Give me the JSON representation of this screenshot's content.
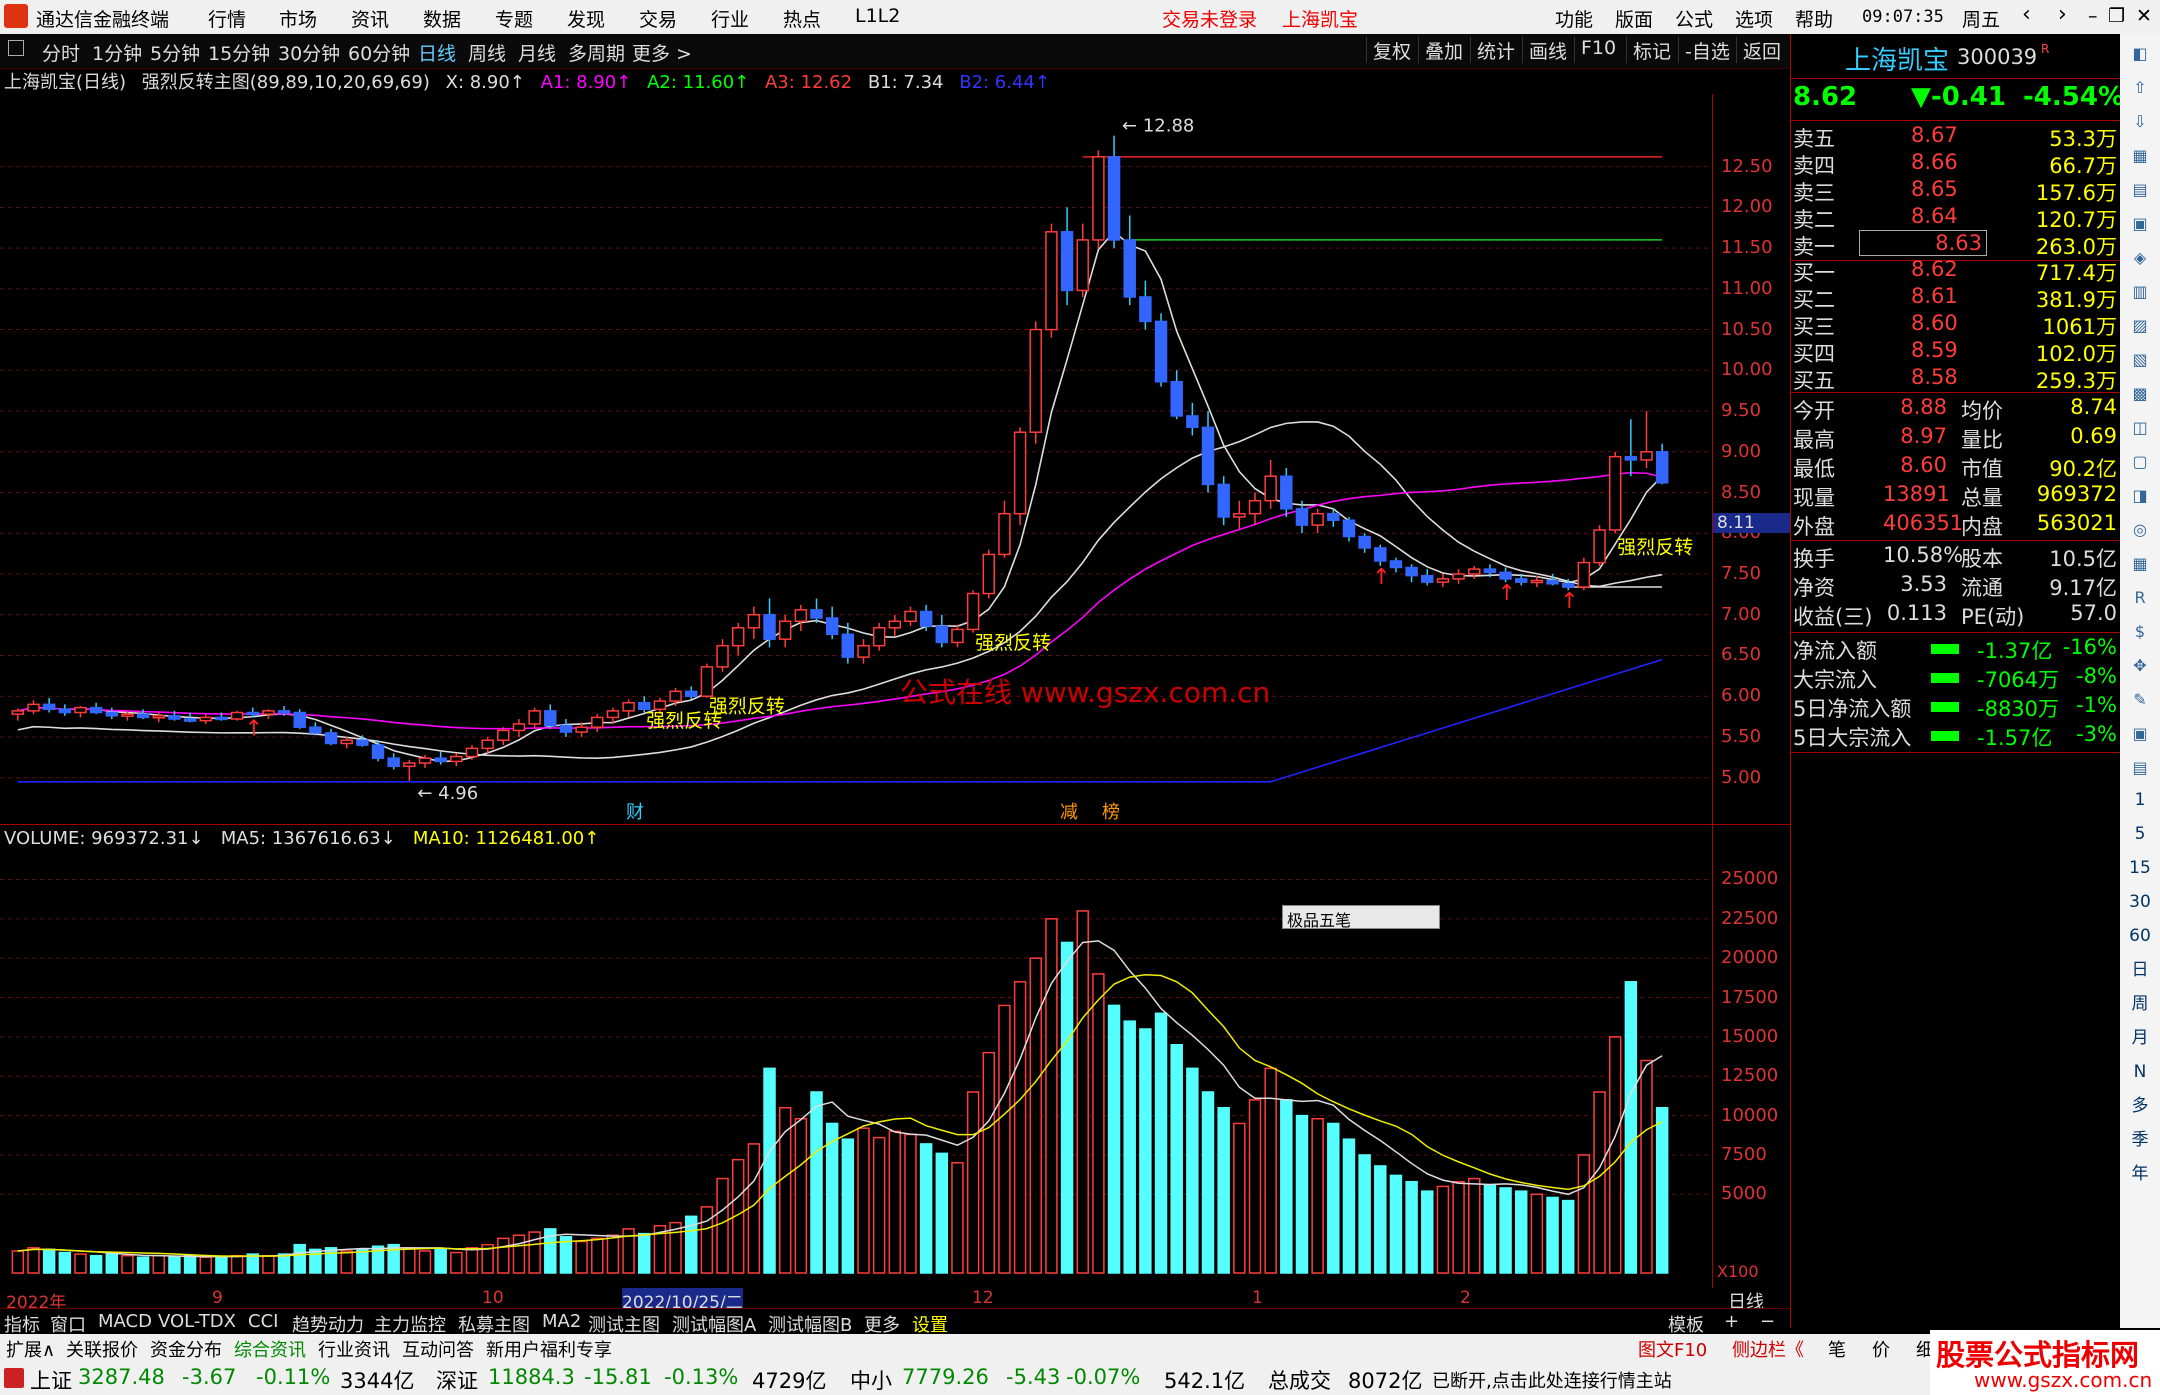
{
  "menubar": {
    "app_title": "通达信金融终端",
    "items": [
      "行情",
      "市场",
      "资讯",
      "数据",
      "专题",
      "发现",
      "交易",
      "行业",
      "热点",
      "L1L2"
    ],
    "status": "交易未登录",
    "stock": "上海凯宝",
    "right_items": [
      "功能",
      "版面",
      "公式",
      "选项",
      "帮助"
    ],
    "time": "09:07:35",
    "weekday": "周五"
  },
  "toolbar": {
    "periods": [
      "分时",
      "1分钟",
      "5分钟",
      "15分钟",
      "30分钟",
      "60分钟",
      "日线",
      "周线",
      "月线",
      "多周期",
      "更多 >"
    ],
    "selected": "日线",
    "right_buttons": [
      "复权",
      "叠加",
      "统计",
      "画线",
      "F10",
      "标记",
      "-自选",
      "返回"
    ]
  },
  "infoline": {
    "title": "上海凯宝(日线)",
    "formula": "强烈反转主图(89,89,10,20,69,69)",
    "x": "X: 8.90↑",
    "a1": "A1: 8.90↑",
    "a2": "A2: 11.60↑",
    "a3": "A3: 12.62",
    "b1": "B1: 7.34",
    "b2": "B2: 6.44↑"
  },
  "main_axis": [
    "12.50",
    "12.00",
    "11.50",
    "11.00",
    "10.50",
    "10.00",
    "9.50",
    "9.00",
    "8.50",
    "8.00",
    "7.50",
    "7.00",
    "6.50",
    "6.00",
    "5.50",
    "5.00"
  ],
  "price_marker": "8.11",
  "annotations": {
    "high": "12.88",
    "low": "4.96",
    "signal": "强烈反转",
    "watermark": "公式在线 www.gszx.com.cn",
    "cai": "财",
    "jian": "减",
    "bang": "榜"
  },
  "volume_info": {
    "volume": "VOLUME: 969372.31↓",
    "ma5": "MA5: 1367616.63↓",
    "ma10": "MA10: 1126481.00↑"
  },
  "vol_axis": [
    "25000",
    "22500",
    "20000",
    "17500",
    "15000",
    "12500",
    "10000",
    "7500",
    "5000"
  ],
  "vol_unit": "X100",
  "popup": "极品五笔",
  "date_axis": [
    "2022年",
    "9",
    "10",
    "2022/10/25/二",
    "12",
    "1",
    "2"
  ],
  "date_axis_label": "日线",
  "quote": {
    "name": "上海凯宝",
    "code": "300039",
    "price": "8.62",
    "change": "▼-0.41",
    "pct": "-4.54%",
    "asks": [
      {
        "label": "卖五",
        "price": "8.67",
        "vol": "53.3万"
      },
      {
        "label": "卖四",
        "price": "8.66",
        "vol": "66.7万"
      },
      {
        "label": "卖三",
        "price": "8.65",
        "vol": "157.6万"
      },
      {
        "label": "卖二",
        "price": "8.64",
        "vol": "120.7万"
      },
      {
        "label": "卖一",
        "price": "8.63",
        "vol": "263.0万"
      }
    ],
    "bids": [
      {
        "label": "买一",
        "price": "8.62",
        "vol": "717.4万"
      },
      {
        "label": "买二",
        "price": "8.61",
        "vol": "381.9万"
      },
      {
        "label": "买三",
        "price": "8.60",
        "vol": "1061万"
      },
      {
        "label": "买四",
        "price": "8.59",
        "vol": "102.0万"
      },
      {
        "label": "买五",
        "price": "8.58",
        "vol": "259.3万"
      }
    ],
    "stats": [
      {
        "l1": "今开",
        "v1": "8.88",
        "l2": "均价",
        "v2": "8.74"
      },
      {
        "l1": "最高",
        "v1": "8.97",
        "l2": "量比",
        "v2": "0.69"
      },
      {
        "l1": "最低",
        "v1": "8.60",
        "l2": "市值",
        "v2": "90.2亿"
      },
      {
        "l1": "现量",
        "v1": "13891",
        "l2": "总量",
        "v2": "969372"
      },
      {
        "l1": "外盘",
        "v1": "406351",
        "l2": "内盘",
        "v2": "563021"
      }
    ],
    "stats2": [
      {
        "l1": "换手",
        "v1": "10.58%",
        "l2": "股本",
        "v2": "10.5亿"
      },
      {
        "l1": "净资",
        "v1": "3.53",
        "l2": "流通",
        "v2": "9.17亿"
      },
      {
        "l1": "收益(三)",
        "v1": "0.113",
        "l2": "PE(动)",
        "v2": "57.0"
      }
    ],
    "flows": [
      {
        "label": "净流入额",
        "val": "-1.37亿",
        "pct": "-16%"
      },
      {
        "label": "大宗流入",
        "val": "-7064万",
        "pct": "-8%"
      },
      {
        "label": "5日净流入额",
        "val": "-8830万",
        "pct": "-1%"
      },
      {
        "label": "5日大宗流入",
        "val": "-1.57亿",
        "pct": "-3%"
      }
    ]
  },
  "side_icons": [
    "1",
    "5",
    "15",
    "30",
    "60",
    "日",
    "周",
    "月",
    "N",
    "多",
    "季",
    "年"
  ],
  "tabs1": [
    "指标",
    "窗口",
    "MACD",
    "VOL-TDX",
    "CCI",
    "趋势动力",
    "主力监控",
    "私募主图",
    "MA2",
    "测试主图",
    "测试幅图A",
    "测试幅图B",
    "更多",
    "设置"
  ],
  "tabs1_right": [
    "模板",
    "+",
    "−"
  ],
  "tabs2": [
    "扩展∧",
    "关联报价",
    "资金分布",
    "综合资讯",
    "行业资讯",
    "互动问答",
    "新用户福利专享"
  ],
  "tabs2_right": [
    "图文F10",
    "侧边栏《",
    "笔",
    "价",
    "细",
    "势"
  ],
  "statusbar": {
    "sh_label": "上证",
    "sh": "3287.48",
    "sh_chg": "-3.67",
    "sh_pct": "-0.11%",
    "sh_amt": "3344亿",
    "sz_label": "深证",
    "sz": "11884.3",
    "sz_chg": "-15.81",
    "sz_pct": "-0.13%",
    "sz_amt": "4729亿",
    "zx_label": "中小",
    "zx": "7779.26",
    "zx_chg": "-5.43",
    "zx_pct": "-0.07%",
    "zx_amt": "542.1亿",
    "total_label": "总成交",
    "total": "8072亿",
    "msg": "已断开,点击此处连接行情主站"
  },
  "brand": {
    "name": "股票公式指标网",
    "url": "www.gszx.com.cn"
  },
  "chart_data": {
    "type": "candlestick",
    "ylim": [
      4.8,
      12.9
    ],
    "vol_ylim": [
      0,
      27000
    ],
    "candles": [
      [
        5.78,
        5.85,
        5.7,
        5.82
      ],
      [
        5.82,
        5.95,
        5.78,
        5.9
      ],
      [
        5.9,
        5.98,
        5.8,
        5.84
      ],
      [
        5.84,
        5.9,
        5.76,
        5.8
      ],
      [
        5.8,
        5.88,
        5.74,
        5.86
      ],
      [
        5.86,
        5.92,
        5.78,
        5.8
      ],
      [
        5.8,
        5.86,
        5.72,
        5.76
      ],
      [
        5.76,
        5.82,
        5.7,
        5.78
      ],
      [
        5.78,
        5.84,
        5.72,
        5.74
      ],
      [
        5.74,
        5.8,
        5.68,
        5.76
      ],
      [
        5.76,
        5.82,
        5.7,
        5.72
      ],
      [
        5.72,
        5.8,
        5.68,
        5.7
      ],
      [
        5.7,
        5.78,
        5.66,
        5.74
      ],
      [
        5.74,
        5.8,
        5.7,
        5.72
      ],
      [
        5.72,
        5.82,
        5.7,
        5.8
      ],
      [
        5.8,
        5.86,
        5.74,
        5.78
      ],
      [
        5.78,
        5.84,
        5.72,
        5.82
      ],
      [
        5.82,
        5.88,
        5.76,
        5.8
      ],
      [
        5.8,
        5.84,
        5.6,
        5.62
      ],
      [
        5.62,
        5.68,
        5.52,
        5.55
      ],
      [
        5.55,
        5.6,
        5.4,
        5.42
      ],
      [
        5.42,
        5.5,
        5.36,
        5.46
      ],
      [
        5.46,
        5.52,
        5.38,
        5.4
      ],
      [
        5.4,
        5.46,
        5.2,
        5.24
      ],
      [
        5.24,
        5.3,
        5.1,
        5.14
      ],
      [
        5.14,
        5.22,
        4.96,
        5.18
      ],
      [
        5.18,
        5.28,
        5.12,
        5.24
      ],
      [
        5.24,
        5.32,
        5.16,
        5.2
      ],
      [
        5.2,
        5.3,
        5.14,
        5.26
      ],
      [
        5.26,
        5.4,
        5.22,
        5.36
      ],
      [
        5.36,
        5.5,
        5.3,
        5.46
      ],
      [
        5.46,
        5.62,
        5.4,
        5.58
      ],
      [
        5.58,
        5.72,
        5.5,
        5.66
      ],
      [
        5.66,
        5.86,
        5.6,
        5.82
      ],
      [
        5.82,
        5.9,
        5.6,
        5.64
      ],
      [
        5.64,
        5.72,
        5.5,
        5.56
      ],
      [
        5.56,
        5.68,
        5.5,
        5.62
      ],
      [
        5.62,
        5.78,
        5.56,
        5.74
      ],
      [
        5.74,
        5.86,
        5.66,
        5.82
      ],
      [
        5.82,
        5.96,
        5.74,
        5.92
      ],
      [
        5.92,
        6.0,
        5.8,
        5.84
      ],
      [
        5.84,
        5.98,
        5.78,
        5.94
      ],
      [
        5.94,
        6.1,
        5.88,
        6.06
      ],
      [
        6.06,
        6.12,
        5.96,
        6.0
      ],
      [
        6.0,
        6.4,
        5.98,
        6.36
      ],
      [
        6.36,
        6.7,
        6.3,
        6.62
      ],
      [
        6.62,
        6.9,
        6.5,
        6.84
      ],
      [
        6.84,
        7.1,
        6.7,
        7.0
      ],
      [
        7.0,
        7.2,
        6.6,
        6.7
      ],
      [
        6.7,
        7.0,
        6.6,
        6.92
      ],
      [
        6.92,
        7.12,
        6.8,
        7.06
      ],
      [
        7.06,
        7.2,
        6.9,
        6.96
      ],
      [
        6.96,
        7.1,
        6.7,
        6.76
      ],
      [
        6.76,
        6.9,
        6.4,
        6.48
      ],
      [
        6.48,
        6.7,
        6.4,
        6.62
      ],
      [
        6.62,
        6.9,
        6.56,
        6.84
      ],
      [
        6.84,
        7.0,
        6.74,
        6.92
      ],
      [
        6.92,
        7.1,
        6.86,
        7.04
      ],
      [
        7.04,
        7.12,
        6.8,
        6.86
      ],
      [
        6.86,
        7.0,
        6.6,
        6.66
      ],
      [
        6.66,
        6.88,
        6.6,
        6.82
      ],
      [
        6.82,
        7.3,
        6.78,
        7.26
      ],
      [
        7.26,
        7.8,
        7.2,
        7.74
      ],
      [
        7.74,
        8.4,
        7.7,
        8.24
      ],
      [
        8.24,
        9.3,
        8.1,
        9.24
      ],
      [
        9.24,
        10.6,
        9.1,
        10.5
      ],
      [
        10.5,
        11.8,
        10.4,
        11.7
      ],
      [
        11.7,
        12.0,
        10.8,
        10.98
      ],
      [
        10.98,
        11.8,
        10.9,
        11.6
      ],
      [
        11.6,
        12.7,
        11.5,
        12.62
      ],
      [
        12.62,
        12.88,
        11.5,
        11.6
      ],
      [
        11.6,
        11.9,
        10.8,
        10.9
      ],
      [
        10.9,
        11.1,
        10.5,
        10.6
      ],
      [
        10.6,
        10.7,
        9.8,
        9.86
      ],
      [
        9.86,
        10.0,
        9.4,
        9.44
      ],
      [
        9.44,
        9.6,
        9.2,
        9.3
      ],
      [
        9.3,
        9.5,
        8.5,
        8.6
      ],
      [
        8.6,
        8.7,
        8.1,
        8.2
      ],
      [
        8.2,
        8.4,
        8.05,
        8.24
      ],
      [
        8.24,
        8.5,
        8.1,
        8.4
      ],
      [
        8.4,
        8.9,
        8.3,
        8.7
      ],
      [
        8.7,
        8.8,
        8.2,
        8.3
      ],
      [
        8.3,
        8.4,
        8.0,
        8.1
      ],
      [
        8.1,
        8.3,
        8.0,
        8.24
      ],
      [
        8.24,
        8.3,
        8.08,
        8.16
      ],
      [
        8.16,
        8.2,
        7.9,
        7.96
      ],
      [
        7.96,
        8.0,
        7.76,
        7.82
      ],
      [
        7.82,
        7.86,
        7.6,
        7.66
      ],
      [
        7.66,
        7.7,
        7.52,
        7.58
      ],
      [
        7.58,
        7.62,
        7.4,
        7.48
      ],
      [
        7.48,
        7.56,
        7.36,
        7.4
      ],
      [
        7.4,
        7.5,
        7.34,
        7.44
      ],
      [
        7.44,
        7.56,
        7.38,
        7.5
      ],
      [
        7.5,
        7.6,
        7.44,
        7.56
      ],
      [
        7.56,
        7.62,
        7.46,
        7.52
      ],
      [
        7.52,
        7.58,
        7.4,
        7.44
      ],
      [
        7.44,
        7.5,
        7.36,
        7.4
      ],
      [
        7.4,
        7.48,
        7.34,
        7.42
      ],
      [
        7.42,
        7.5,
        7.36,
        7.38
      ],
      [
        7.38,
        7.44,
        7.3,
        7.34
      ],
      [
        7.34,
        7.7,
        7.3,
        7.64
      ],
      [
        7.64,
        8.1,
        7.6,
        8.04
      ],
      [
        8.04,
        9.0,
        8.0,
        8.94
      ],
      [
        8.94,
        9.4,
        8.7,
        8.9
      ],
      [
        8.9,
        9.5,
        8.8,
        9.0
      ],
      [
        9.0,
        9.1,
        8.6,
        8.62
      ]
    ],
    "volumes": [
      1400,
      1600,
      1500,
      1300,
      1200,
      1100,
      1200,
      1100,
      1000,
      1100,
      1000,
      1100,
      1000,
      1000,
      1100,
      1200,
      1100,
      1200,
      1800,
      1500,
      1600,
      1400,
      1500,
      1700,
      1800,
      1600,
      1400,
      1500,
      1300,
      1600,
      1800,
      2200,
      2400,
      2600,
      2800,
      2300,
      2000,
      2200,
      2400,
      2800,
      2500,
      3000,
      3200,
      3600,
      4200,
      6000,
      7200,
      8200,
      13000,
      10500,
      9800,
      11500,
      9500,
      8500,
      9200,
      8600,
      9000,
      8800,
      8200,
      7600,
      7000,
      11500,
      14000,
      17000,
      18500,
      20000,
      22500,
      21000,
      23000,
      19000,
      17000,
      16000,
      15500,
      16500,
      14500,
      13000,
      11500,
      10500,
      9500,
      11000,
      13000,
      11000,
      10000,
      9800,
      9500,
      8500,
      7500,
      6800,
      6200,
      5800,
      5200,
      5500,
      5800,
      6000,
      5600,
      5400,
      5200,
      5000,
      4800,
      4600,
      7500,
      11500,
      15000,
      18500,
      13500,
      10500
    ]
  }
}
